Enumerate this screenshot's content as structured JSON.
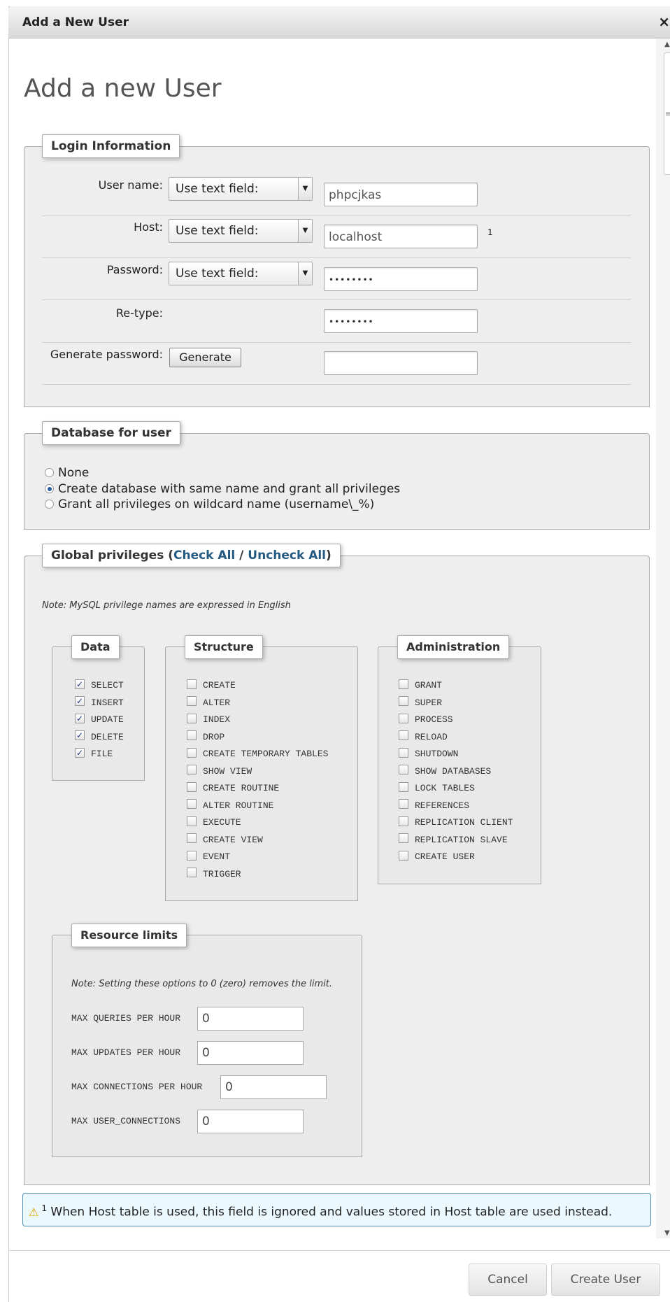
{
  "dialog": {
    "title": "Add a New User",
    "close_glyph": "×",
    "close_icon": "close-icon"
  },
  "page": {
    "heading": "Add a new User"
  },
  "login": {
    "legend": "Login Information",
    "username_label": "User name:",
    "username_mode": "Use text field:",
    "username_value": "phpcjkas",
    "host_label": "Host:",
    "host_mode": "Use text field:",
    "host_value": "localhost",
    "host_footnote": "1",
    "password_label": "Password:",
    "password_mode": "Use text field:",
    "password_value": "••••••••",
    "retype_label": "Re-type:",
    "retype_value": "••••••••",
    "generate_label": "Generate password:",
    "generate_button": "Generate",
    "generated_value": ""
  },
  "database": {
    "legend": "Database for user",
    "options": [
      {
        "label": "None",
        "selected": false
      },
      {
        "label": "Create database with same name and grant all privileges",
        "selected": true
      },
      {
        "label": "Grant all privileges on wildcard name (username\\_%)",
        "selected": false
      }
    ]
  },
  "global": {
    "legend_prefix": "Global privileges (",
    "check_all": "Check All",
    "separator": " / ",
    "uncheck_all": "Uncheck All",
    "legend_suffix": ")",
    "note": "Note: MySQL privilege names are expressed in English",
    "groups": {
      "data": {
        "legend": "Data",
        "items": [
          {
            "label": "SELECT",
            "checked": true
          },
          {
            "label": "INSERT",
            "checked": true
          },
          {
            "label": "UPDATE",
            "checked": true
          },
          {
            "label": "DELETE",
            "checked": true
          },
          {
            "label": "FILE",
            "checked": true
          }
        ]
      },
      "structure": {
        "legend": "Structure",
        "items": [
          {
            "label": "CREATE",
            "checked": false
          },
          {
            "label": "ALTER",
            "checked": false
          },
          {
            "label": "INDEX",
            "checked": false
          },
          {
            "label": "DROP",
            "checked": false
          },
          {
            "label": "CREATE TEMPORARY TABLES",
            "checked": false
          },
          {
            "label": "SHOW VIEW",
            "checked": false
          },
          {
            "label": "CREATE ROUTINE",
            "checked": false
          },
          {
            "label": "ALTER ROUTINE",
            "checked": false
          },
          {
            "label": "EXECUTE",
            "checked": false
          },
          {
            "label": "CREATE VIEW",
            "checked": false
          },
          {
            "label": "EVENT",
            "checked": false
          },
          {
            "label": "TRIGGER",
            "checked": false
          }
        ]
      },
      "administration": {
        "legend": "Administration",
        "items": [
          {
            "label": "GRANT",
            "checked": false
          },
          {
            "label": "SUPER",
            "checked": false
          },
          {
            "label": "PROCESS",
            "checked": false
          },
          {
            "label": "RELOAD",
            "checked": false
          },
          {
            "label": "SHUTDOWN",
            "checked": false
          },
          {
            "label": "SHOW DATABASES",
            "checked": false
          },
          {
            "label": "LOCK TABLES",
            "checked": false
          },
          {
            "label": "REFERENCES",
            "checked": false
          },
          {
            "label": "REPLICATION CLIENT",
            "checked": false
          },
          {
            "label": "REPLICATION SLAVE",
            "checked": false
          },
          {
            "label": "CREATE USER",
            "checked": false
          }
        ]
      }
    },
    "resources": {
      "legend": "Resource limits",
      "note": "Note: Setting these options to 0 (zero) removes the limit.",
      "max_queries_label": "MAX QUERIES PER HOUR",
      "max_queries_value": "0",
      "max_updates_label": "MAX UPDATES PER HOUR",
      "max_updates_value": "0",
      "max_connections_label": "MAX CONNECTIONS PER HOUR",
      "max_connections_value": "0",
      "max_user_connections_label": "MAX USER_CONNECTIONS",
      "max_user_connections_value": "0"
    }
  },
  "notice": {
    "icon": "warning-icon",
    "glyph": "⚠",
    "footnote": "1",
    "text": " When Host table is used, this field is ignored and values stored in Host table are used instead."
  },
  "footer": {
    "cancel": "Cancel",
    "create": "Create User"
  },
  "scrollbar": {
    "up_glyph": "▲",
    "down_glyph": "▼",
    "grip_glyph": "≡"
  }
}
